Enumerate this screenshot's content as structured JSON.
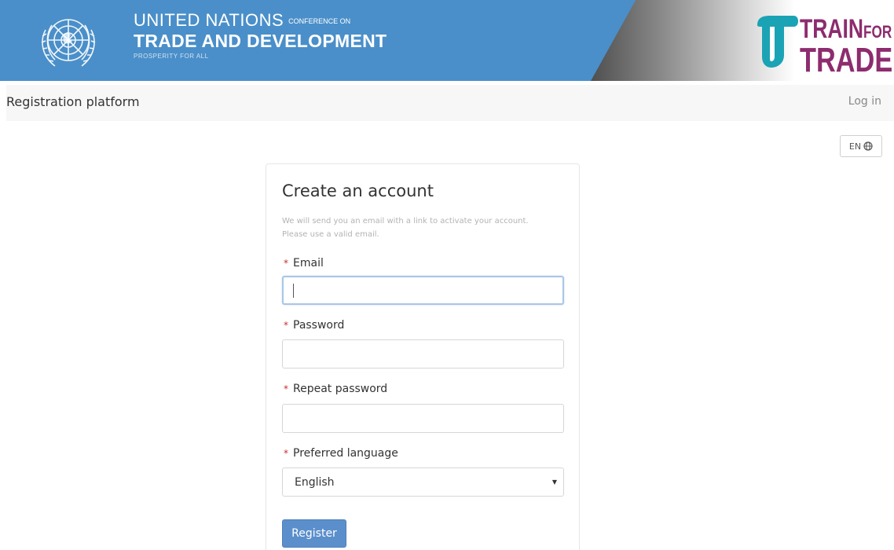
{
  "banner": {
    "un_line1": "UNITED NATIONS",
    "un_line1_small": "CONFERENCE ON",
    "un_line2": "TRADE AND DEVELOPMENT",
    "un_line3": "PROSPERITY FOR ALL",
    "tft_train": "TRAIN",
    "tft_for": "FOR",
    "tft_trade": "TRADE",
    "colors": {
      "un_blue": "#4a8fc9",
      "tft_purple": "#8d2c6e",
      "tft_teal": "#1aa3b4"
    }
  },
  "navbar": {
    "brand": "Registration platform",
    "login": "Log in"
  },
  "language_button": {
    "label": "EN",
    "icon": "globe-icon"
  },
  "form": {
    "title": "Create an account",
    "help_line1": "We will send you an email with a link to activate your account.",
    "help_line2": "Please use a valid email.",
    "required_marker": "*",
    "email_label": "Email",
    "email_value": "",
    "password_label": "Password",
    "password_value": "",
    "repeat_password_label": "Repeat password",
    "repeat_password_value": "",
    "language_label": "Preferred language",
    "language_selected": "English",
    "register_label": "Register",
    "accent_color": "#5b8fcb"
  }
}
